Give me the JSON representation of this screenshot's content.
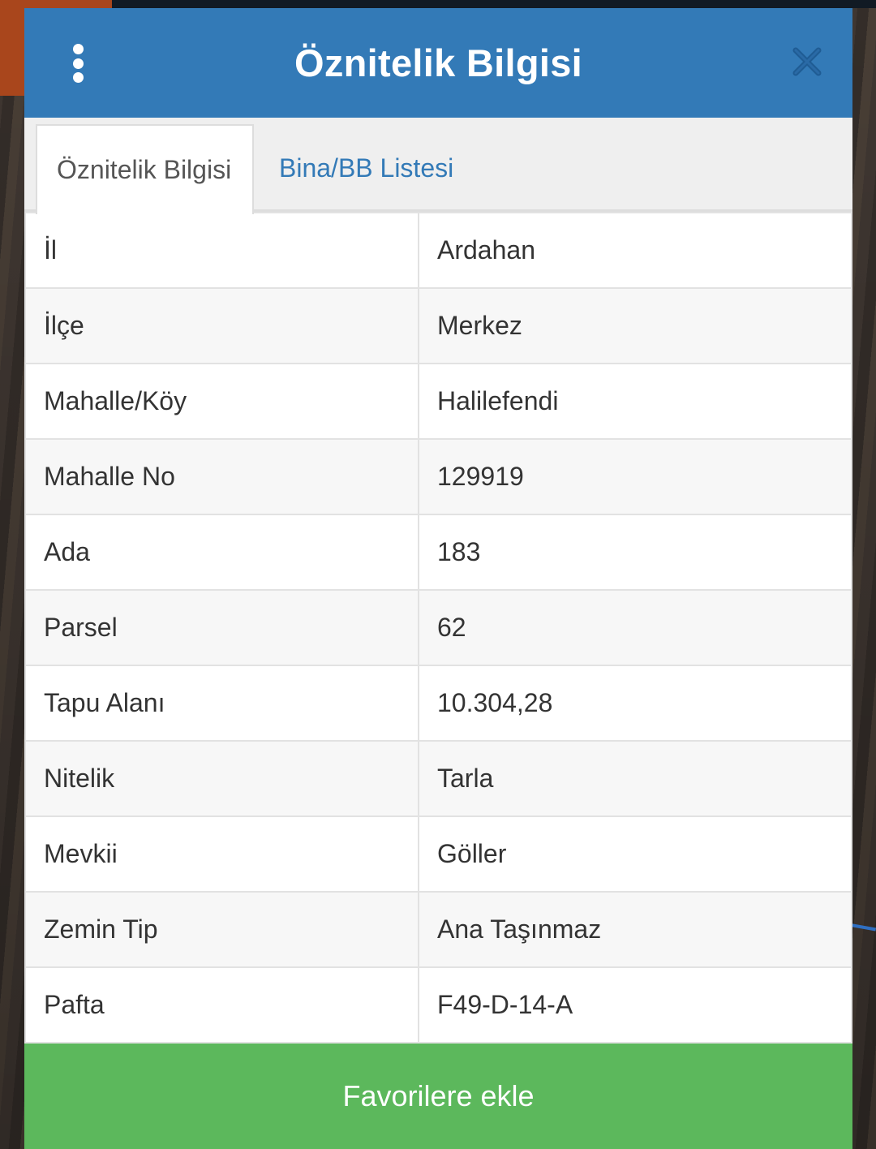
{
  "dialog": {
    "title": "Öznitelik Bilgisi",
    "menu_icon": "more-vertical-icon",
    "close_icon": "close-icon"
  },
  "tabs": [
    {
      "label": "Öznitelik Bilgisi",
      "active": true
    },
    {
      "label": "Bina/BB Listesi",
      "active": false
    }
  ],
  "attributes": [
    {
      "key": "İl",
      "value": "Ardahan"
    },
    {
      "key": "İlçe",
      "value": "Merkez"
    },
    {
      "key": "Mahalle/Köy",
      "value": "Halilefendi"
    },
    {
      "key": "Mahalle No",
      "value": "129919"
    },
    {
      "key": "Ada",
      "value": "183"
    },
    {
      "key": "Parsel",
      "value": "62"
    },
    {
      "key": "Tapu Alanı",
      "value": "10.304,28"
    },
    {
      "key": "Nitelik",
      "value": "Tarla"
    },
    {
      "key": "Mevkii",
      "value": "Göller"
    },
    {
      "key": "Zemin Tip",
      "value": "Ana Taşınmaz"
    },
    {
      "key": "Pafta",
      "value": "F49-D-14-A"
    }
  ],
  "footer": {
    "favorite_label": "Favorilere ekle"
  },
  "colors": {
    "header": "#337ab7",
    "link": "#337ab7",
    "button": "#5cb85c"
  }
}
